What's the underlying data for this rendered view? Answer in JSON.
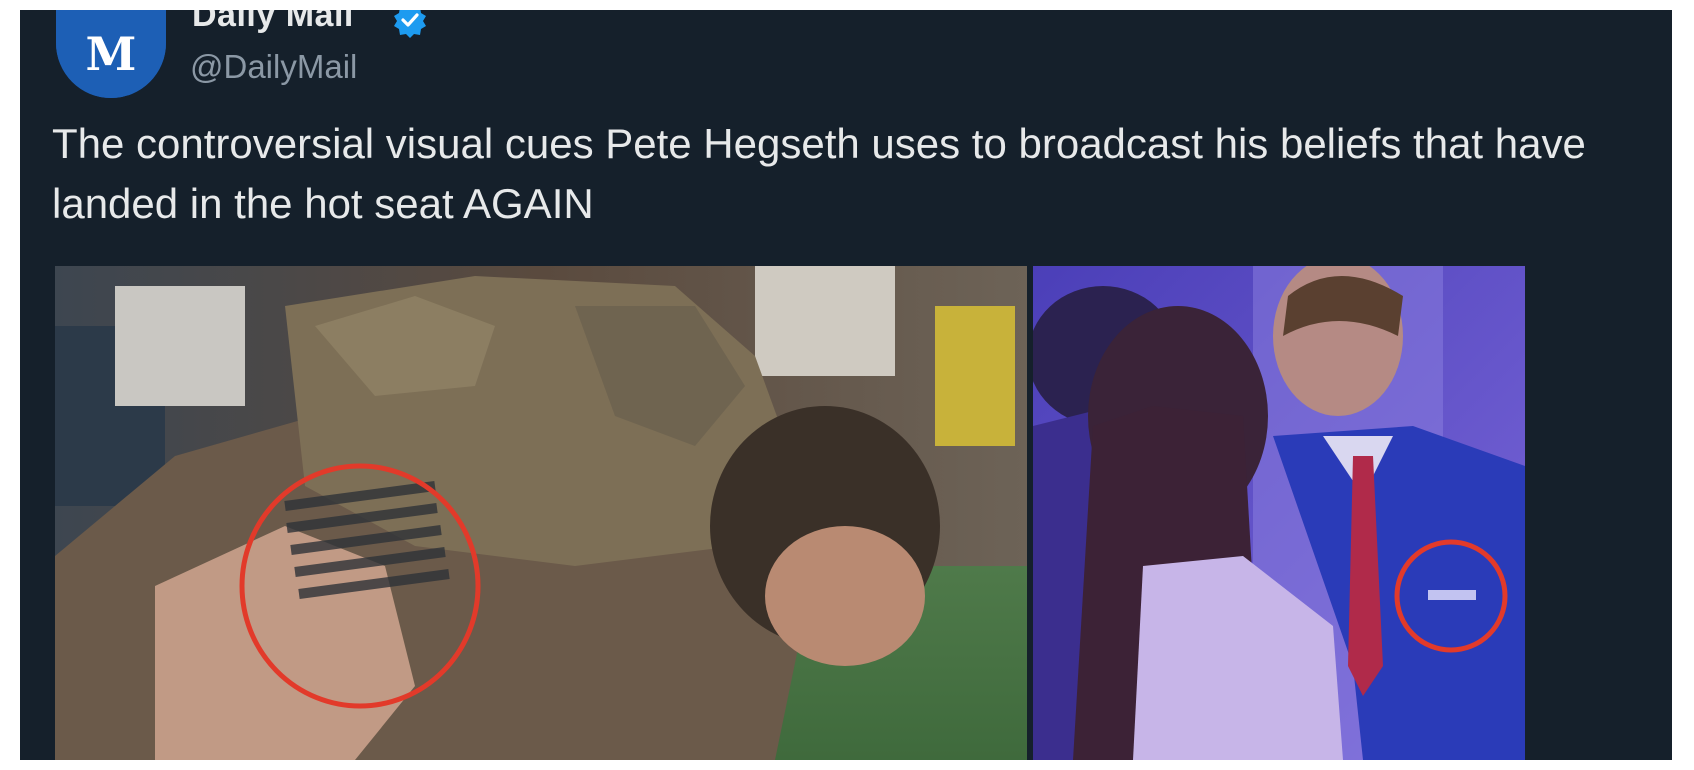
{
  "tweet": {
    "display_name": "Daily Mail",
    "handle": "@DailyMail",
    "text": "The controversial visual cues Pete Hegseth uses to broadcast his beliefs that have landed in the hot seat AGAIN",
    "avatar_icon": "daily-mail-logo-icon",
    "badge_icon": "verified-badge-icon"
  },
  "media": {
    "images": [
      "workout-photo-tattoo",
      "event-photo-pin"
    ],
    "highlight_color": "#e23a2a"
  },
  "colors": {
    "background": "#15202b",
    "text": "#e7e9ea",
    "secondary_text": "#8b98a5",
    "avatar": "#1d5fb5",
    "verified": "#1d9bf0"
  }
}
